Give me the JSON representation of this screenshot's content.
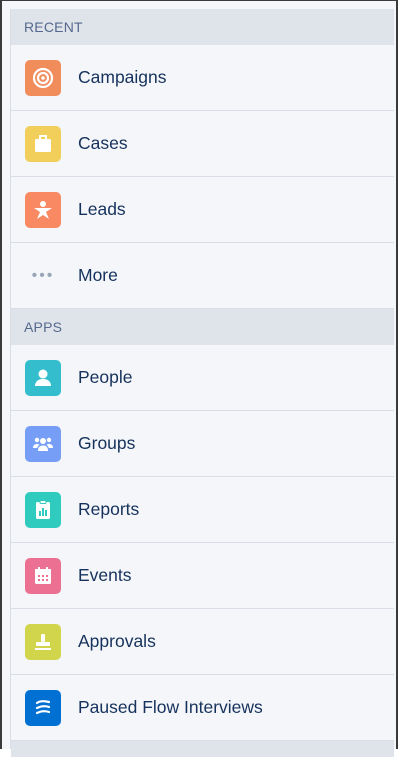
{
  "recent": {
    "header": "RECENT",
    "items": [
      {
        "label": "Campaigns",
        "icon": "target-icon",
        "color": "#f18c5b"
      },
      {
        "label": "Cases",
        "icon": "briefcase-icon",
        "color": "#f2cf5b"
      },
      {
        "label": "Leads",
        "icon": "person-star-icon",
        "color": "#f88962"
      },
      {
        "label": "More",
        "icon": "more-dots-icon"
      }
    ]
  },
  "apps": {
    "header": "APPS",
    "items": [
      {
        "label": "People",
        "icon": "person-icon",
        "color": "#34becd"
      },
      {
        "label": "Groups",
        "icon": "groups-icon",
        "color": "#779ef7"
      },
      {
        "label": "Reports",
        "icon": "report-icon",
        "color": "#2ecbbe"
      },
      {
        "label": "Events",
        "icon": "calendar-icon",
        "color": "#eb7092"
      },
      {
        "label": "Approvals",
        "icon": "stamp-icon",
        "color": "#d1d54b"
      },
      {
        "label": "Paused Flow Interviews",
        "icon": "flow-icon",
        "color": "#0070d2"
      }
    ]
  }
}
